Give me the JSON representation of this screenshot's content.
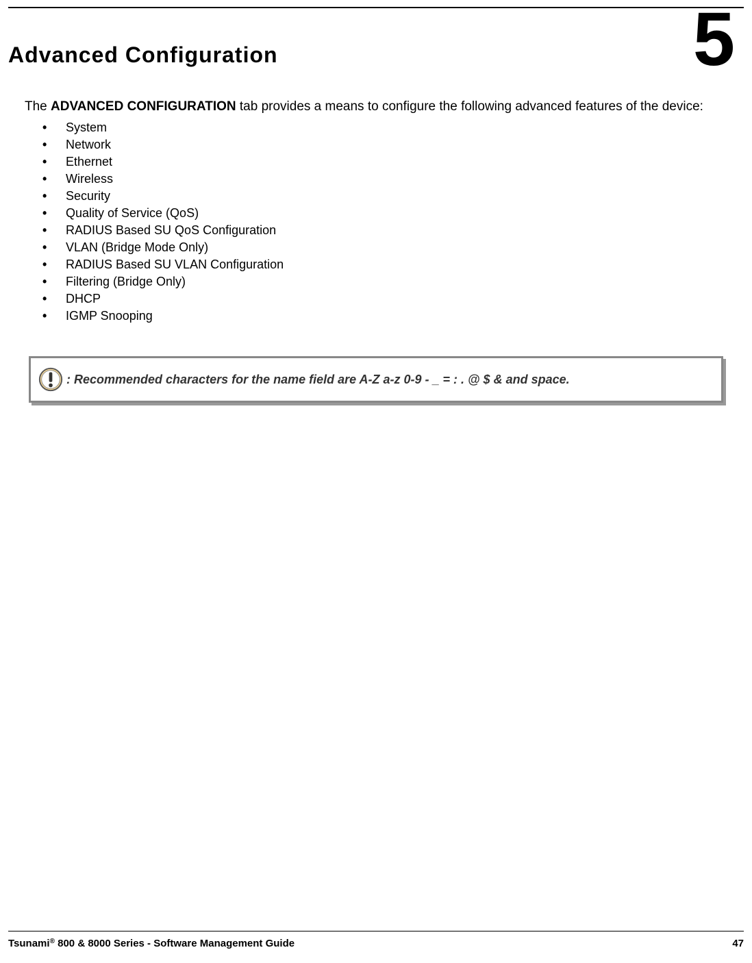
{
  "chapter": {
    "number": "5",
    "title": "Advanced Configuration"
  },
  "intro": {
    "prefix": "The ",
    "tab_name": "ADVANCED CONFIGURATION",
    "suffix": " tab provides a means to configure the following advanced features of the device:"
  },
  "features": [
    "System",
    "Network",
    "Ethernet",
    "Wireless",
    "Security",
    "Quality of Service (QoS)",
    "RADIUS Based SU QoS Configuration",
    "VLAN (Bridge Mode Only)",
    "RADIUS Based SU VLAN Configuration",
    "Filtering (Bridge Only)",
    "DHCP",
    "IGMP Snooping"
  ],
  "note": {
    "text": ": Recommended characters for the name field are A-Z  a-z  0-9  - _ = :  . @ $ & and space."
  },
  "footer": {
    "brand": "Tsunami",
    "reg": "®",
    "doc": " 800 & 8000 Series - Software Management Guide",
    "page": "47"
  }
}
